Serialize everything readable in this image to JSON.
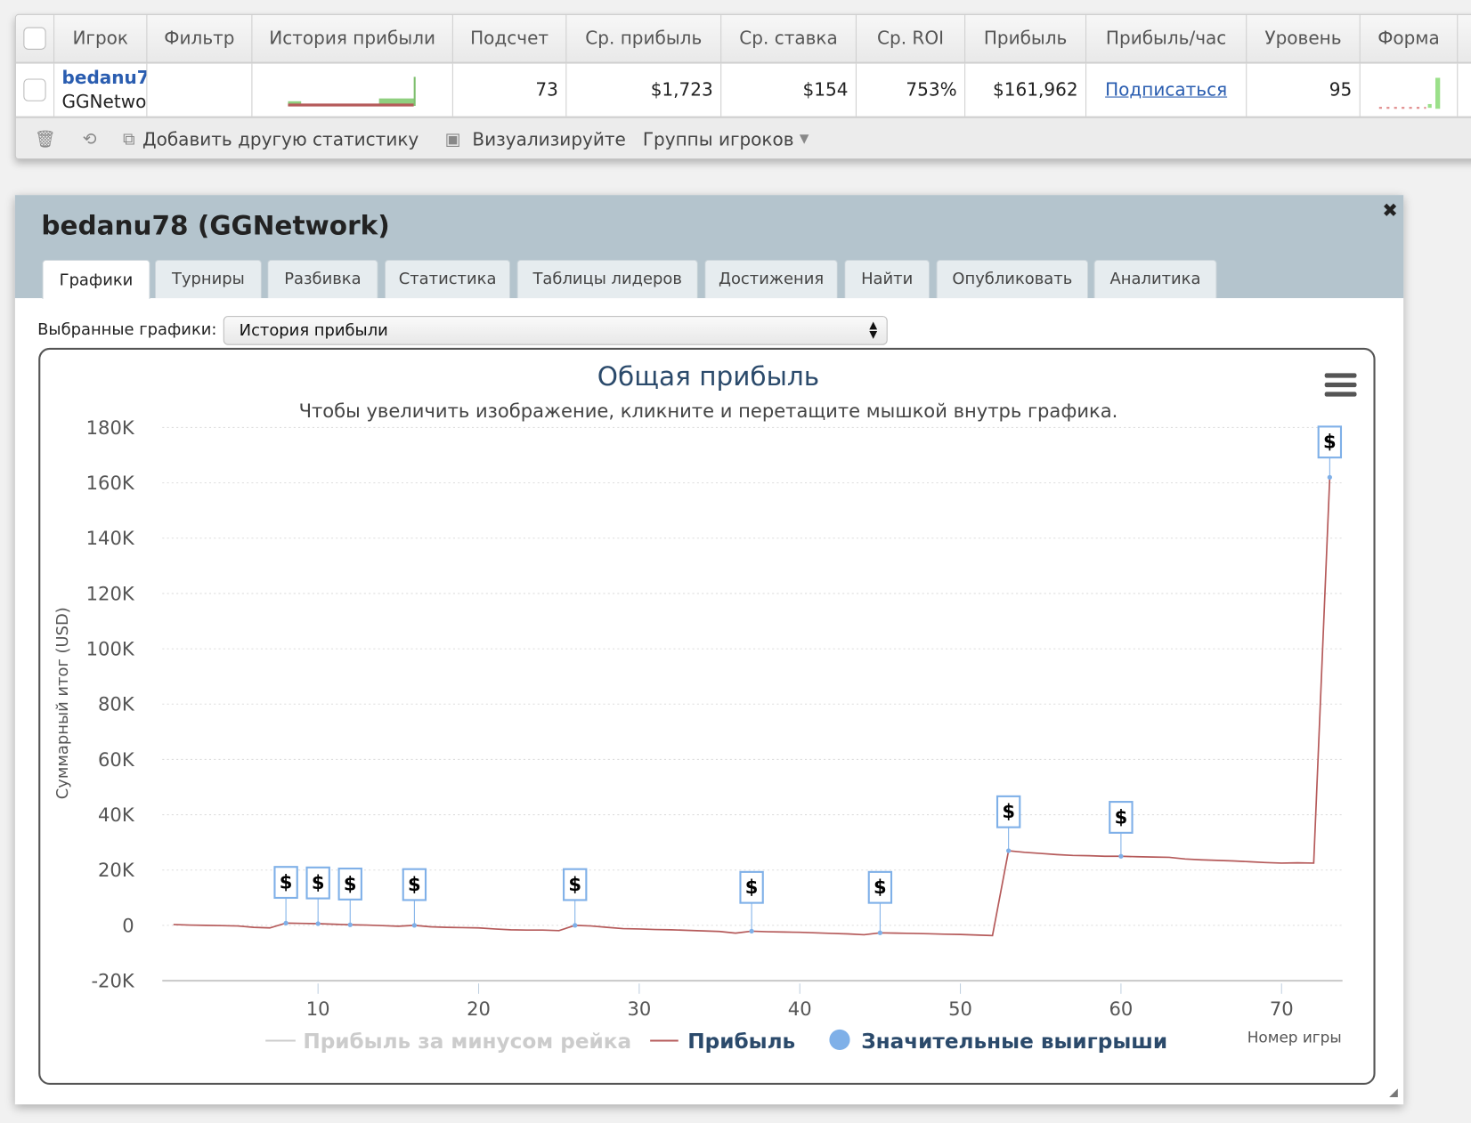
{
  "table": {
    "headers": [
      "Игрок",
      "Фильтр",
      "История прибыли",
      "Подсчет",
      "Ср. прибыль",
      "Ср. ставка",
      "Ср. ROI",
      "Прибыль",
      "Прибыль/час",
      "Уровень",
      "Форма"
    ],
    "row": {
      "player_name": "bedanu7",
      "network": "GGNetwo",
      "count": "73",
      "avg_profit": "$1,723",
      "avg_stake": "$154",
      "avg_roi": "753%",
      "profit": "$161,962",
      "profit_per_hour": "Подписаться",
      "level": "95"
    },
    "toolbar": {
      "add_stat": "Добавить другую статистику",
      "visualize": "Визуализируйте",
      "player_groups": "Группы игроков"
    }
  },
  "dialog": {
    "title": "bedanu78 (GGNetwork)",
    "close": "✖",
    "tabs": [
      "Графики",
      "Турниры",
      "Разбивка",
      "Статистика",
      "Таблицы лидеров",
      "Достижения",
      "Найти",
      "Опубликовать",
      "Аналитика"
    ],
    "active_tab": "Графики",
    "select_label": "Выбранные графики:",
    "select_value": "История прибыли"
  },
  "colors": {
    "profit": "#b55a5a",
    "wins": "#7fb0e8",
    "rake": "#cccccc",
    "link": "#2a5db0"
  },
  "chart_data": {
    "type": "line",
    "title": "Общая прибыль",
    "subtitle": "Чтобы увеличить изображение, кликните и перетащите мышкой внутрь графика.",
    "xlabel": "Номер игры",
    "ylabel": "Суммарный итог (USD)",
    "ylim": [
      -20000,
      180000
    ],
    "yticks": [
      -20000,
      0,
      20000,
      40000,
      60000,
      80000,
      100000,
      120000,
      140000,
      160000,
      180000
    ],
    "ytick_labels": [
      "-20K",
      "0",
      "20K",
      "40K",
      "60K",
      "80K",
      "100K",
      "120K",
      "140K",
      "160K",
      "180K"
    ],
    "xticks": [
      10,
      20,
      30,
      40,
      50,
      60,
      70
    ],
    "grid": true,
    "legend": [
      "Прибыль за минусом рейка",
      "Прибыль",
      "Значительные выигрыши"
    ],
    "legend_position": "bottom",
    "series": [
      {
        "name": "Прибыль",
        "x_start": 1,
        "values": [
          300,
          100,
          0,
          -100,
          -200,
          -700,
          -900,
          800,
          700,
          600,
          400,
          200,
          100,
          -100,
          -300,
          0,
          -500,
          -700,
          -800,
          -900,
          -1300,
          -1600,
          -1700,
          -1700,
          -1900,
          0,
          -200,
          -700,
          -1200,
          -1300,
          -1500,
          -1600,
          -1800,
          -2000,
          -2200,
          -2800,
          -2100,
          -2300,
          -2400,
          -2500,
          -2700,
          -2900,
          -3100,
          -3400,
          -2700,
          -2800,
          -2900,
          -3000,
          -3200,
          -3300,
          -3500,
          -3700,
          27000,
          26400,
          26000,
          25600,
          25300,
          25200,
          25000,
          25000,
          24800,
          24700,
          24600,
          24000,
          23700,
          23500,
          23300,
          23000,
          22700,
          22500,
          22600,
          22500,
          162000
        ]
      }
    ],
    "significant_wins": {
      "games": [
        8,
        10,
        12,
        16,
        26,
        37,
        45,
        53,
        60,
        73
      ],
      "marker": "$"
    }
  }
}
